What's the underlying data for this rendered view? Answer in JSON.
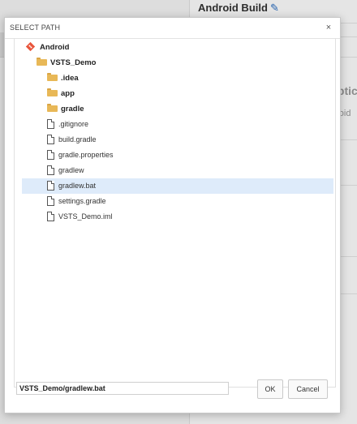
{
  "background": {
    "title": "Android Build",
    "section_heading_partial": "Optic",
    "field_partial": "droid"
  },
  "dialog": {
    "title": "SELECT PATH",
    "close_glyph": "×",
    "tree": [
      {
        "label": "Android",
        "kind": "repo",
        "depth": 0
      },
      {
        "label": "VSTS_Demo",
        "kind": "folder",
        "depth": 1
      },
      {
        "label": ".idea",
        "kind": "folder",
        "depth": 2
      },
      {
        "label": "app",
        "kind": "folder",
        "depth": 2
      },
      {
        "label": "gradle",
        "kind": "folder",
        "depth": 2
      },
      {
        "label": ".gitignore",
        "kind": "file",
        "depth": 2
      },
      {
        "label": "build.gradle",
        "kind": "file",
        "depth": 2
      },
      {
        "label": "gradle.properties",
        "kind": "file",
        "depth": 2
      },
      {
        "label": "gradlew",
        "kind": "file",
        "depth": 2
      },
      {
        "label": "gradlew.bat",
        "kind": "file",
        "depth": 2,
        "selected": true
      },
      {
        "label": "settings.gradle",
        "kind": "file",
        "depth": 2
      },
      {
        "label": "VSTS_Demo.iml",
        "kind": "file",
        "depth": 2
      }
    ],
    "path_value": "VSTS_Demo/gradlew.bat",
    "ok_label": "OK",
    "cancel_label": "Cancel"
  },
  "colors": {
    "selection": "#deebfa",
    "folder": "#e8b857",
    "repo": "#e9553b"
  }
}
